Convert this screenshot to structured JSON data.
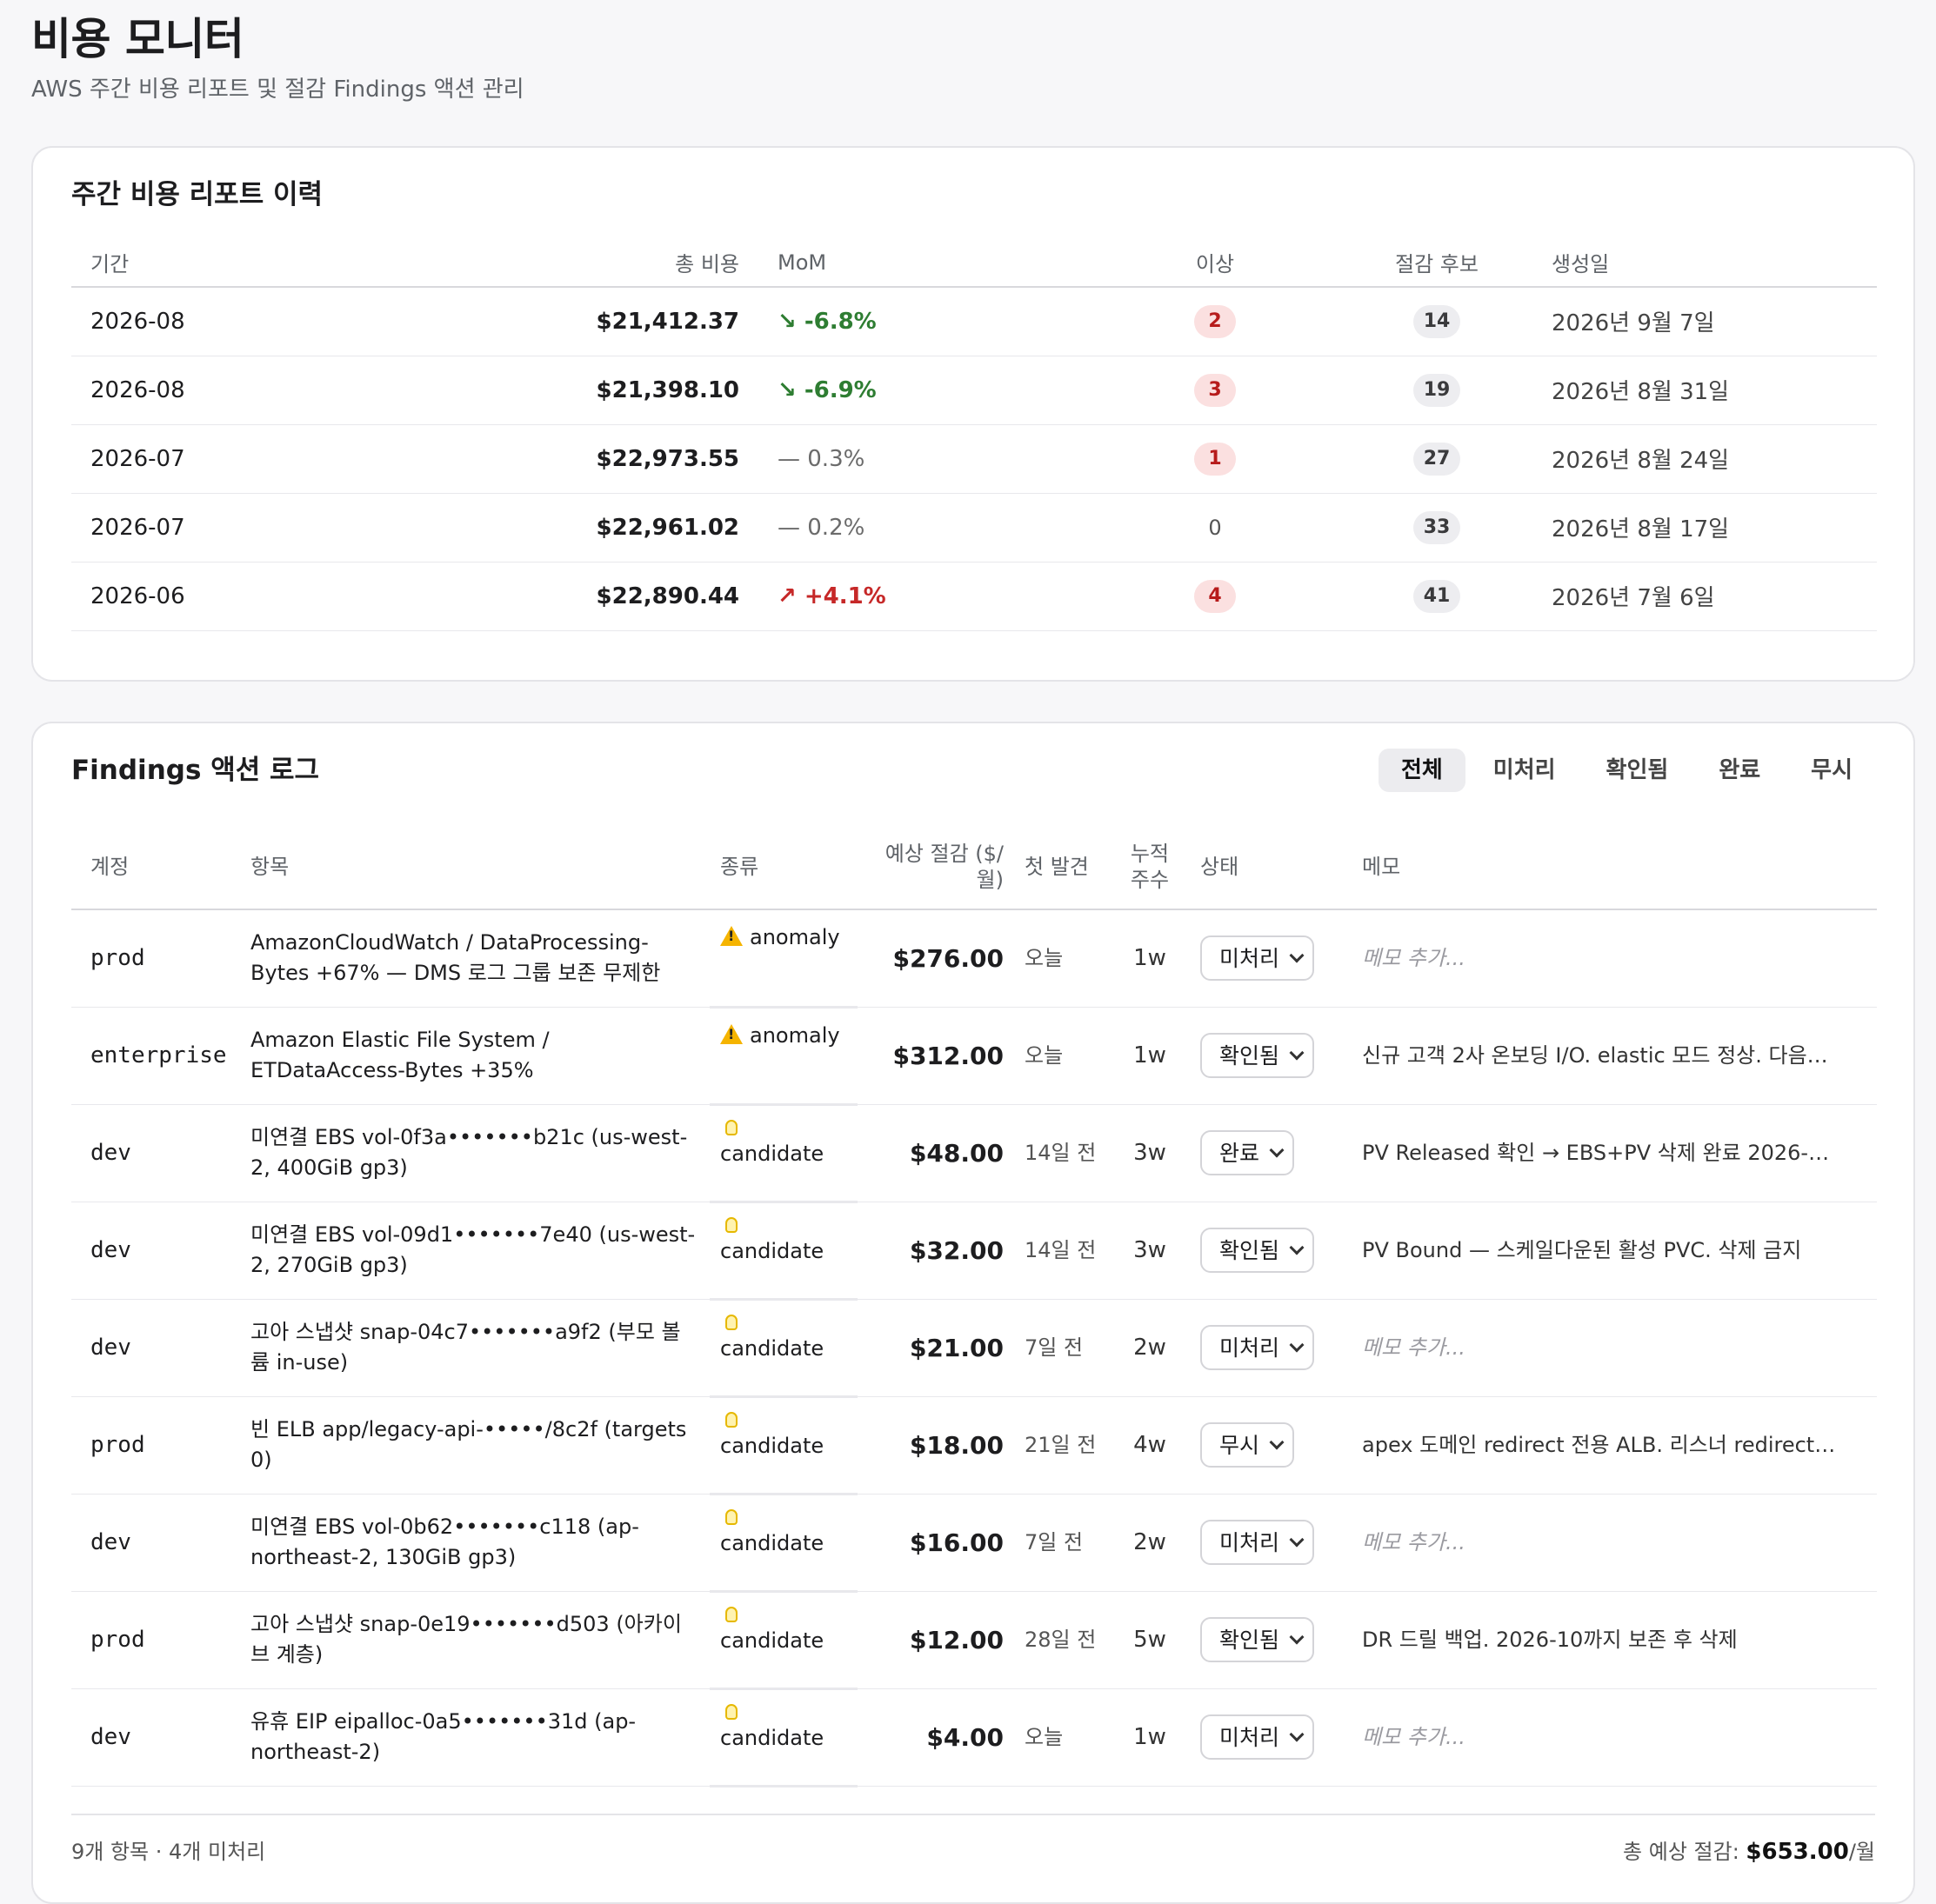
{
  "header": {
    "title": "비용 모니터",
    "subtitle": "AWS 주간 비용 리포트 및 절감 Findings 액션 관리"
  },
  "reports": {
    "title": "주간 비용 리포트 이력",
    "columns": [
      "기간",
      "총 비용",
      "MoM",
      "이상",
      "절감 후보",
      "생성일"
    ],
    "rows": [
      {
        "period": "2026-08",
        "total": "$21,412.37",
        "mom": "↘ -6.8%",
        "trend": "down",
        "anomalies": "2",
        "candidates": "14",
        "created": "2026년 9월 7일"
      },
      {
        "period": "2026-08",
        "total": "$21,398.10",
        "mom": "↘ -6.9%",
        "trend": "down",
        "anomalies": "3",
        "candidates": "19",
        "created": "2026년 8월 31일"
      },
      {
        "period": "2026-07",
        "total": "$22,973.55",
        "mom": "— 0.3%",
        "trend": "flat",
        "anomalies": "1",
        "candidates": "27",
        "created": "2026년 8월 24일"
      },
      {
        "period": "2026-07",
        "total": "$22,961.02",
        "mom": "— 0.2%",
        "trend": "flat",
        "anomalies": "0",
        "candidates": "33",
        "created": "2026년 8월 17일"
      },
      {
        "period": "2026-06",
        "total": "$22,890.44",
        "mom": "↗ +4.1%",
        "trend": "up",
        "anomalies": "4",
        "candidates": "41",
        "created": "2026년 7월 6일"
      }
    ]
  },
  "findings": {
    "title": "Findings 액션 로그",
    "filters": [
      "전체",
      "미처리",
      "확인됨",
      "완료",
      "무시"
    ],
    "active_filter": "전체",
    "columns": {
      "account": "계정",
      "item": "항목",
      "kind": "종류",
      "saving": "예상 절감 ($/월)",
      "first_seen": "첫 발견",
      "weeks": "누적 주수",
      "status": "상태",
      "memo": "메모"
    },
    "rows": [
      {
        "account": "prod",
        "item": "AmazonCloudWatch / DataProcessing-Bytes +67% — DMS 로그 그룹 보존 무제한",
        "kind": "anomaly",
        "kind_icon": "warning-icon",
        "saving": "$276.00",
        "first_seen": "오늘",
        "weeks": "1w",
        "status": "미처리",
        "memo": "메모 추가...",
        "memo_placeholder": true
      },
      {
        "account": "enterprise",
        "item": "Amazon Elastic File System / ETDataAccess-Bytes +35%",
        "kind": "anomaly",
        "kind_icon": "warning-icon",
        "saving": "$312.00",
        "first_seen": "오늘",
        "weeks": "1w",
        "status": "확인됨",
        "memo": "신규 고객 2사 온보딩 I/O. elastic 모드 정상. 다음…",
        "memo_placeholder": false
      },
      {
        "account": "dev",
        "item": "미연결 EBS vol-0f3a•••••••b21c (us-west-2, 400GiB gp3)",
        "kind": "candidate",
        "kind_icon": "lightbulb-icon",
        "saving": "$48.00",
        "first_seen": "14일 전",
        "weeks": "3w",
        "status": "완료",
        "memo": "PV Released 확인 → EBS+PV 삭제 완료 2026-…",
        "memo_placeholder": false
      },
      {
        "account": "dev",
        "item": "미연결 EBS vol-09d1•••••••7e40 (us-west-2, 270GiB gp3)",
        "kind": "candidate",
        "kind_icon": "lightbulb-icon",
        "saving": "$32.00",
        "first_seen": "14일 전",
        "weeks": "3w",
        "status": "확인됨",
        "memo": "PV Bound — 스케일다운된 활성 PVC. 삭제 금지",
        "memo_placeholder": false
      },
      {
        "account": "dev",
        "item": "고아 스냅샷 snap-04c7•••••••a9f2 (부모 볼륨 in-use)",
        "kind": "candidate",
        "kind_icon": "lightbulb-icon",
        "saving": "$21.00",
        "first_seen": "7일 전",
        "weeks": "2w",
        "status": "미처리",
        "memo": "메모 추가...",
        "memo_placeholder": true
      },
      {
        "account": "prod",
        "item": "빈 ELB app/legacy-api-•••••/8c2f (targets 0)",
        "kind": "candidate",
        "kind_icon": "lightbulb-icon",
        "saving": "$18.00",
        "first_seen": "21일 전",
        "weeks": "4w",
        "status": "무시",
        "memo": "apex 도메인 redirect 전용 ALB. 리스너 redirect…",
        "memo_placeholder": false
      },
      {
        "account": "dev",
        "item": "미연결 EBS vol-0b62•••••••c118 (ap-northeast-2, 130GiB gp3)",
        "kind": "candidate",
        "kind_icon": "lightbulb-icon",
        "saving": "$16.00",
        "first_seen": "7일 전",
        "weeks": "2w",
        "status": "미처리",
        "memo": "메모 추가...",
        "memo_placeholder": true
      },
      {
        "account": "prod",
        "item": "고아 스냅샷 snap-0e19•••••••d503 (아카이브 계층)",
        "kind": "candidate",
        "kind_icon": "lightbulb-icon",
        "saving": "$12.00",
        "first_seen": "28일 전",
        "weeks": "5w",
        "status": "확인됨",
        "memo": "DR 드릴 백업. 2026-10까지 보존 후 삭제",
        "memo_placeholder": false
      },
      {
        "account": "dev",
        "item": "유휴 EIP eipalloc-0a5•••••••31d (ap-northeast-2)",
        "kind": "candidate",
        "kind_icon": "lightbulb-icon",
        "saving": "$4.00",
        "first_seen": "오늘",
        "weeks": "1w",
        "status": "미처리",
        "memo": "메모 추가...",
        "memo_placeholder": true
      }
    ],
    "footer_left": "9개 항목 · 4개 미처리",
    "footer_right_label": "총 예상 절감: ",
    "footer_right_value": "$653.00",
    "footer_right_unit": "/월"
  },
  "colors": {
    "trend_down": "#2e7d32",
    "trend_up": "#c62828",
    "anomaly_pill_bg": "#fbe0e0",
    "candidate_pill_bg": "#ededf0",
    "warning": "#f5b400"
  }
}
